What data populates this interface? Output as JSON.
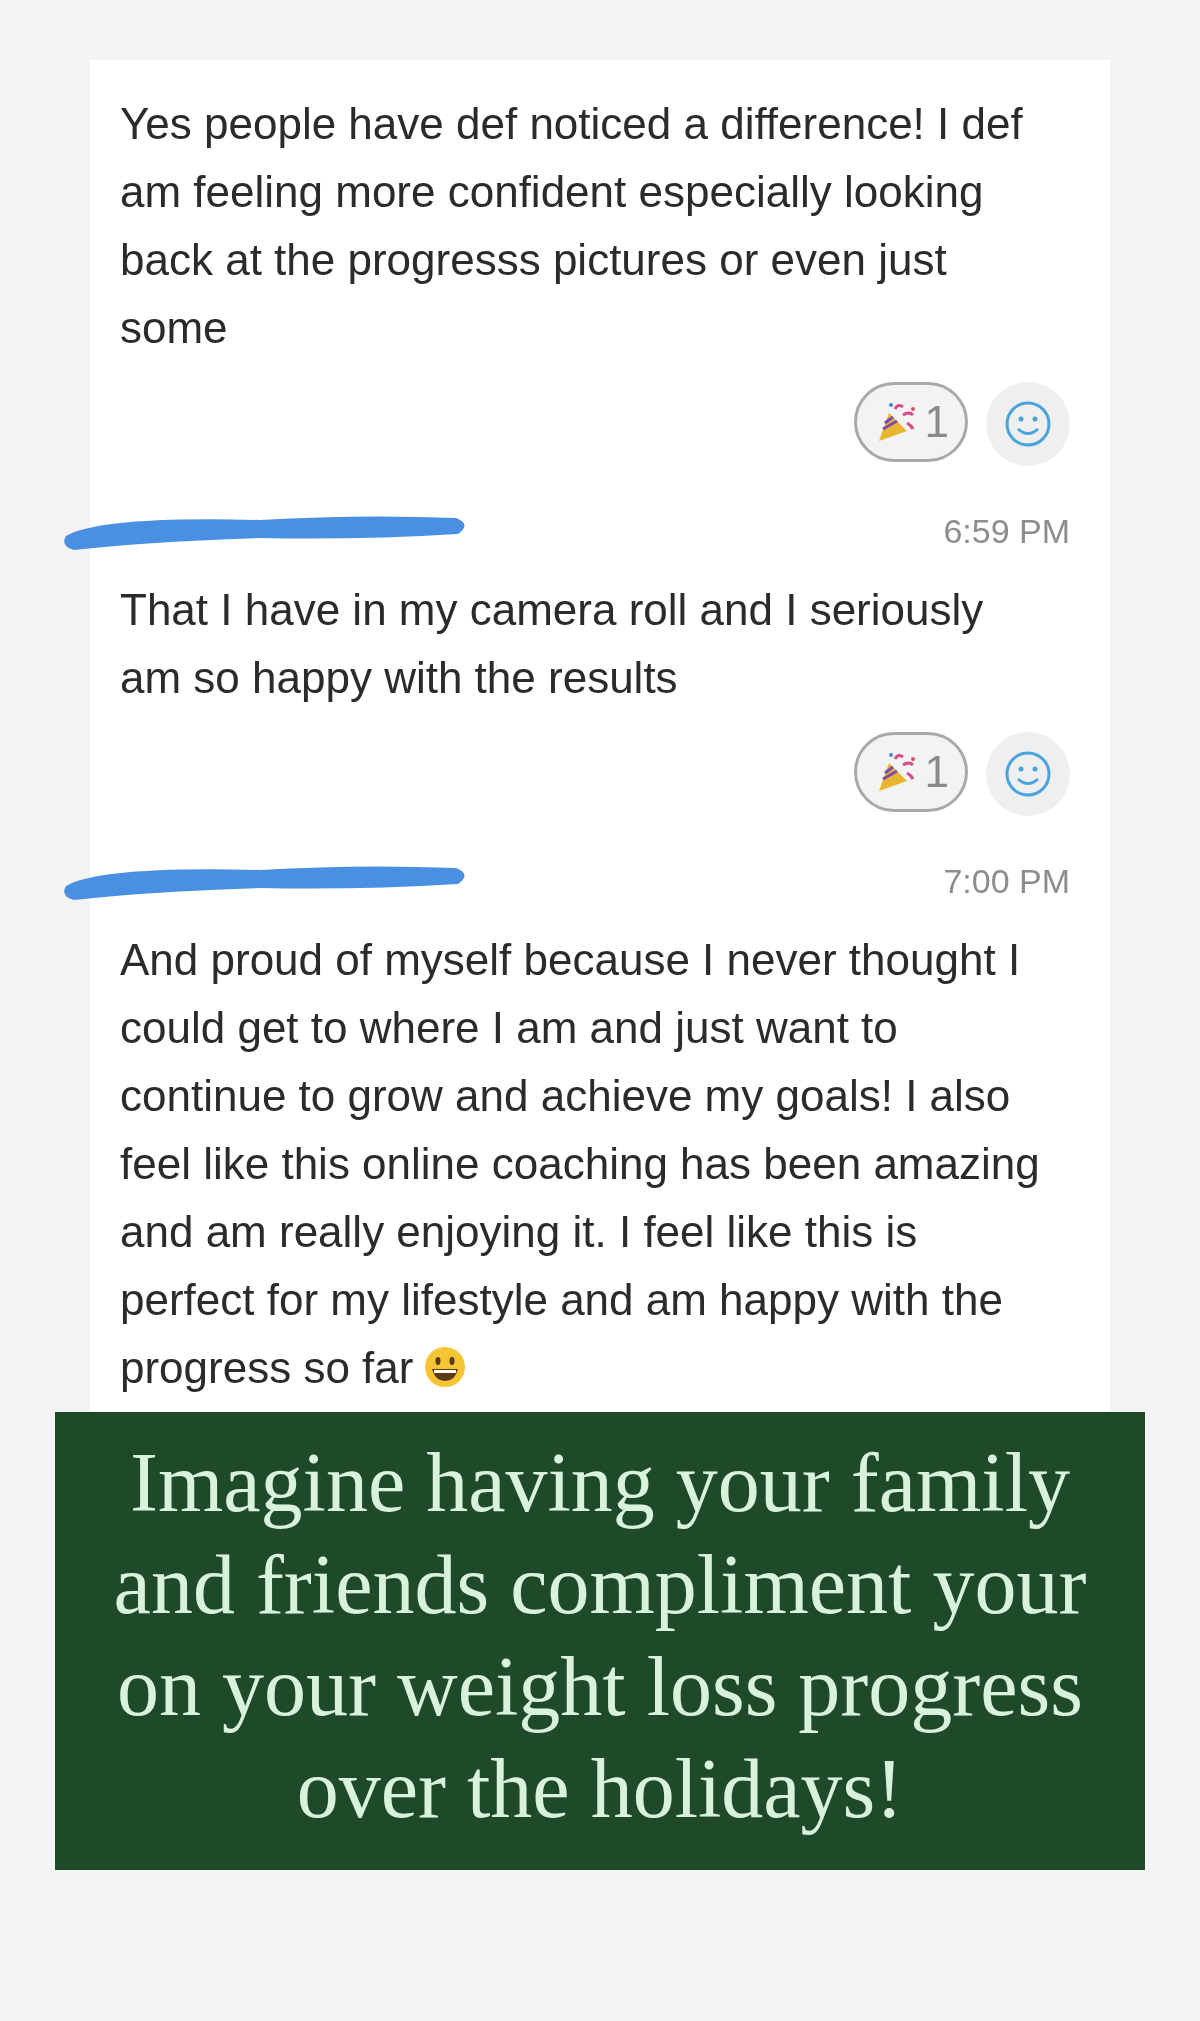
{
  "messages": [
    {
      "text": "Yes people have def noticed a difference! I def am feeling more confident especially looking back at the progresss pictures or even just some",
      "reaction": {
        "count": "1"
      },
      "emoji_end": false
    },
    {
      "time": "6:59 PM",
      "text": "That I have in my camera roll and I seriously am so happy with the results",
      "reaction": {
        "count": "1"
      },
      "emoji_end": false
    },
    {
      "time": "7:00 PM",
      "text": "And proud of myself because I never thought I could get to where I am and just want to continue to grow and achieve my goals! I also feel like this online coaching has been amazing and am really enjoying it. I feel like this is perfect for my lifestyle and am happy with the progress so far",
      "emoji_end": true
    }
  ],
  "banner": {
    "text": "Imagine having your family and friends compliment your on your weight loss progress over the holidays!"
  }
}
